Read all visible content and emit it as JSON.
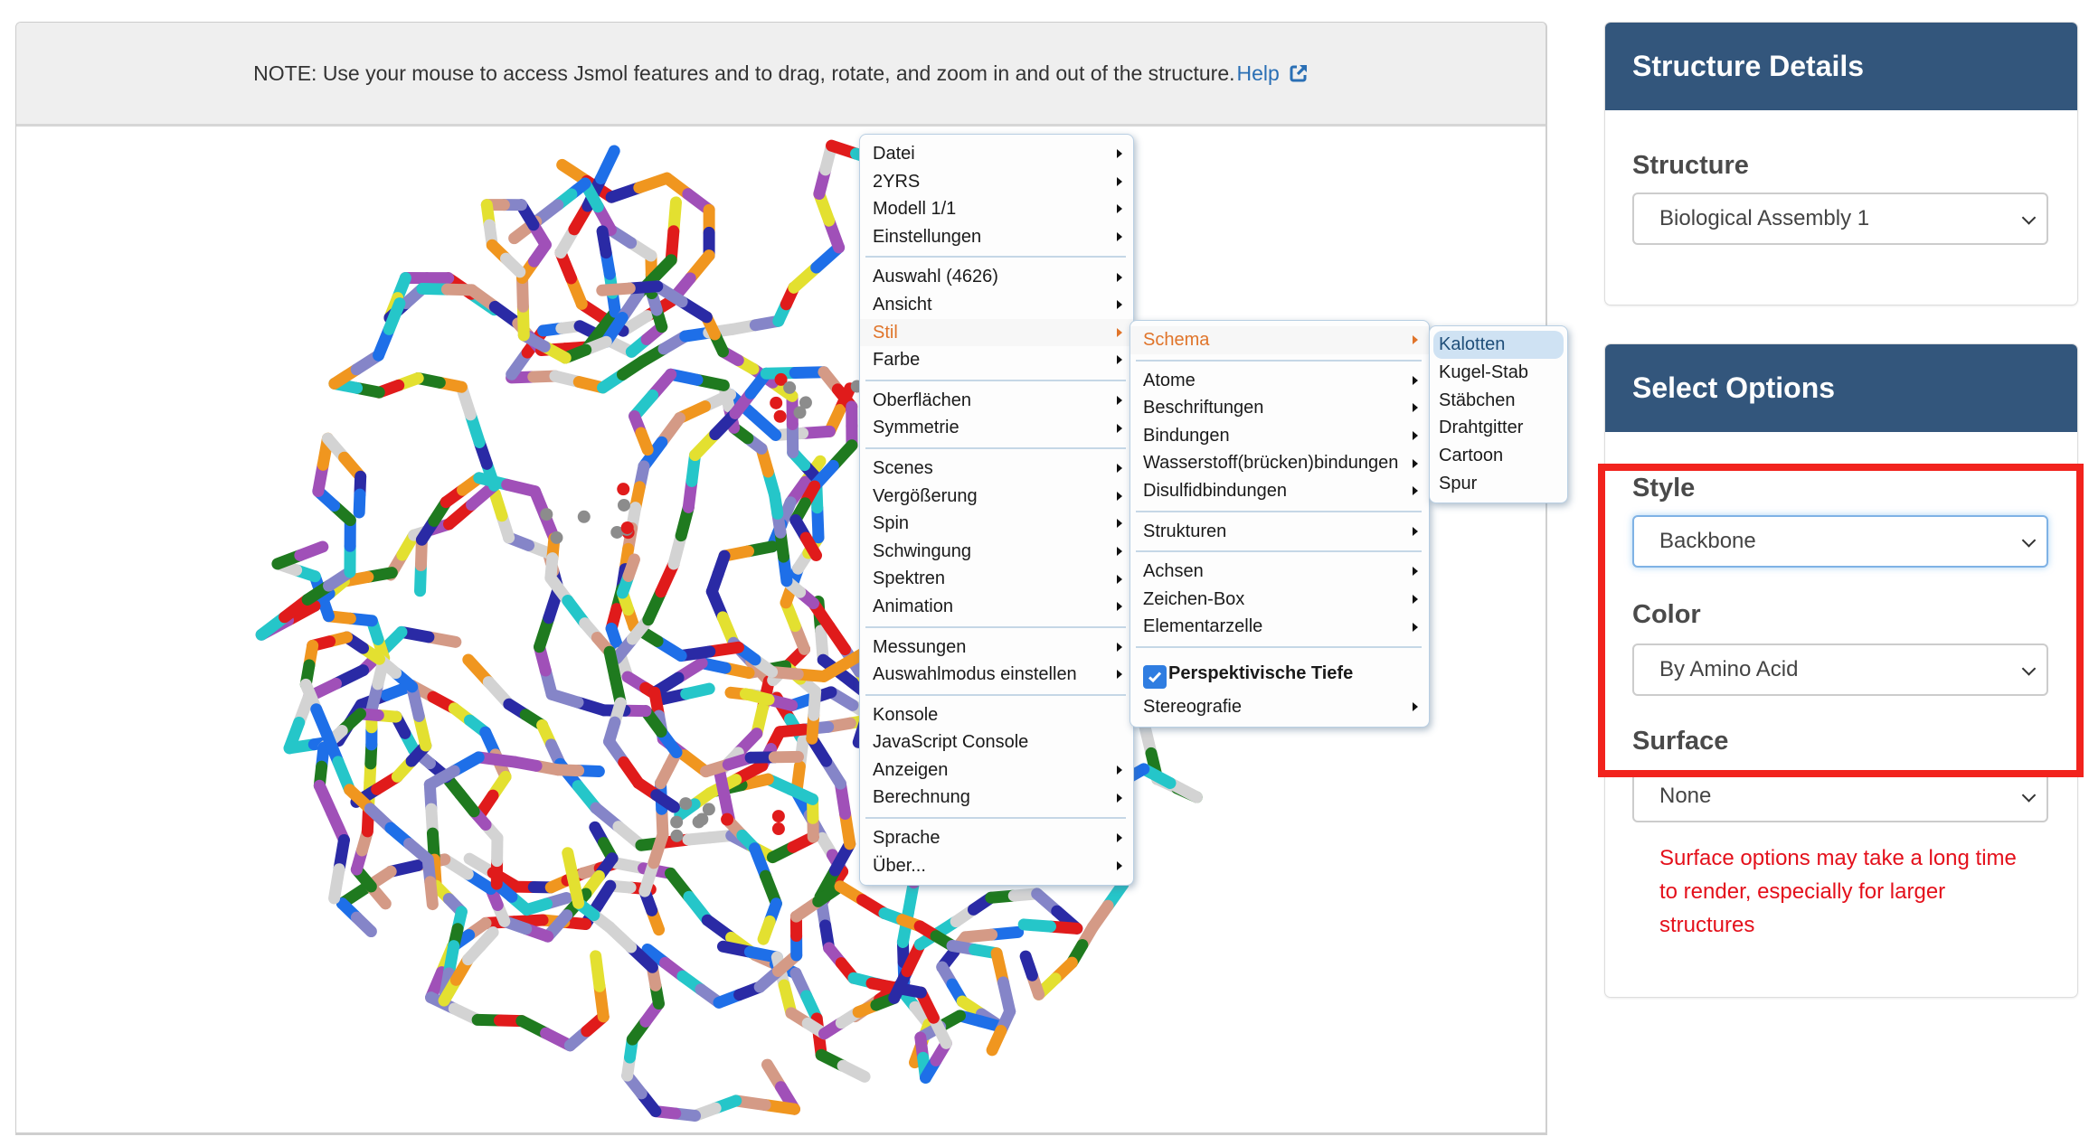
{
  "viewer": {
    "note_text": "NOTE: Use your mouse to access Jsmol features and to drag, rotate, and zoom in and out of the structure.",
    "help_link": "Help",
    "help_icon": "external-link-icon",
    "molecule_style": "backbone",
    "residue_colors": [
      "#d3d3d3",
      "#1e6fe8",
      "#1f7a1f",
      "#25c6c9",
      "#e01b1b",
      "#f0961f",
      "#8585c8",
      "#2a2aa5",
      "#d49a86",
      "#e3e030",
      "#a050b8"
    ]
  },
  "context_menu": {
    "main": [
      {
        "label": "Datei",
        "submenu": true
      },
      {
        "label": "2YRS",
        "submenu": true
      },
      {
        "label": "Modell 1/1",
        "submenu": true
      },
      {
        "label": "Einstellungen",
        "submenu": true
      },
      {
        "separator": true
      },
      {
        "label": "Auswahl (4626)",
        "submenu": true
      },
      {
        "label": "Ansicht",
        "submenu": true
      },
      {
        "label": "Stil",
        "submenu": true,
        "active": true
      },
      {
        "label": "Farbe",
        "submenu": true
      },
      {
        "separator": true
      },
      {
        "label": "Oberflächen",
        "submenu": true
      },
      {
        "label": "Symmetrie",
        "submenu": true
      },
      {
        "separator": true
      },
      {
        "label": "Scenes",
        "submenu": true
      },
      {
        "label": "Vergößerung",
        "submenu": true
      },
      {
        "label": "Spin",
        "submenu": true
      },
      {
        "label": "Schwingung",
        "submenu": true
      },
      {
        "label": "Spektren",
        "submenu": true
      },
      {
        "label": "Animation",
        "submenu": true
      },
      {
        "separator": true
      },
      {
        "label": "Messungen",
        "submenu": true
      },
      {
        "label": "Auswahlmodus einstellen",
        "submenu": true
      },
      {
        "separator": true
      },
      {
        "label": "Konsole",
        "submenu": false
      },
      {
        "label": "JavaScript Console",
        "submenu": false
      },
      {
        "label": "Anzeigen",
        "submenu": true
      },
      {
        "label": "Berechnung",
        "submenu": true
      },
      {
        "separator": true
      },
      {
        "label": "Sprache",
        "submenu": true
      },
      {
        "label": "Über...",
        "submenu": true
      }
    ],
    "stil": [
      {
        "label": "Schema",
        "submenu": true,
        "active": true
      },
      {
        "separator": true
      },
      {
        "label": "Atome",
        "submenu": true
      },
      {
        "label": "Beschriftungen",
        "submenu": true
      },
      {
        "label": "Bindungen",
        "submenu": true
      },
      {
        "label": "Wasserstoff(brücken)bindungen",
        "submenu": true
      },
      {
        "label": "Disulfidbindungen",
        "submenu": true
      },
      {
        "separator": true
      },
      {
        "label": "Strukturen",
        "submenu": true
      },
      {
        "separator": true
      },
      {
        "label": "Achsen",
        "submenu": true
      },
      {
        "label": "Zeichen-Box",
        "submenu": true
      },
      {
        "label": "Elementarzelle",
        "submenu": true
      },
      {
        "separator": true
      },
      {
        "label": "Perspektivische Tiefe",
        "checkbox": true,
        "checked": true
      },
      {
        "label": "Stereografie",
        "submenu": true
      }
    ],
    "schema": [
      {
        "label": "Kalotten",
        "highlighted": true
      },
      {
        "label": "Kugel-Stab"
      },
      {
        "label": "Stäbchen"
      },
      {
        "label": "Drahtgitter"
      },
      {
        "label": "Cartoon"
      },
      {
        "label": "Spur"
      }
    ]
  },
  "structure_details": {
    "title": "Structure Details",
    "structure_label": "Structure",
    "structure_value": "Biological Assembly 1"
  },
  "select_options": {
    "title": "Select Options",
    "style_label": "Style",
    "style_value": "Backbone",
    "color_label": "Color",
    "color_value": "By Amino Acid",
    "surface_label": "Surface",
    "surface_value": "None",
    "surface_warning": "Surface options may take a long time to render, especially for larger structures"
  },
  "colors": {
    "panel_header": "#33567c",
    "link": "#2a6fb5",
    "active_menu": "#e0742a",
    "warning": "#e4101b",
    "highlight_box": "#f2231d"
  }
}
